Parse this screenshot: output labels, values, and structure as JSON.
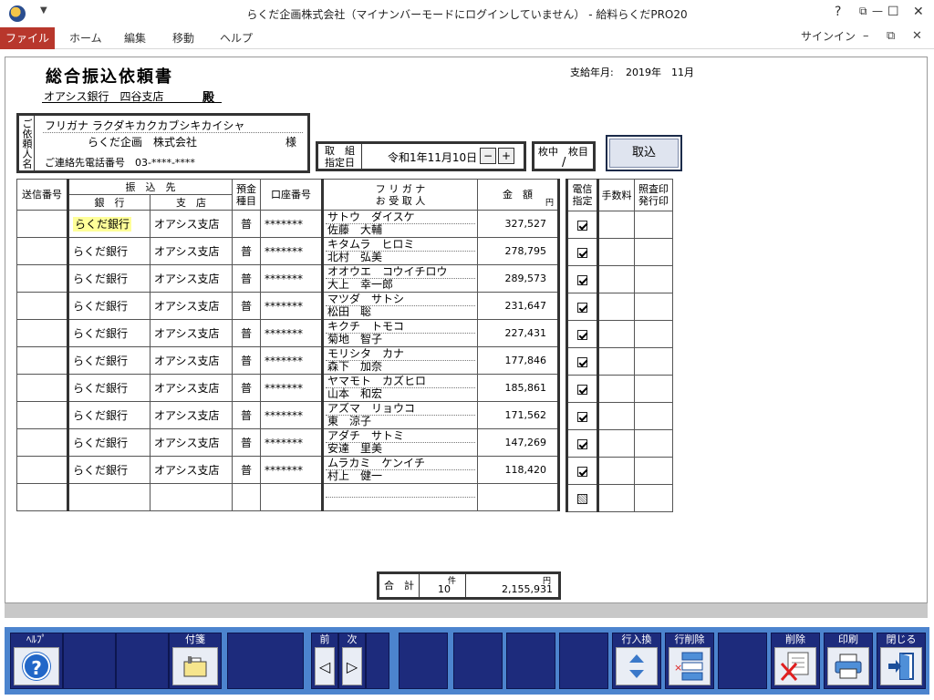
{
  "window": {
    "title": "らくだ企画株式会社（マイナンバーモードにログインしていません） - 給料らくだPRO20",
    "qat_glyph": "▼",
    "controls": {
      "help": "?",
      "restore": "⧉",
      "minimize": "—",
      "maximize": "☐",
      "close": "✕"
    }
  },
  "menu": {
    "file": "ファイル",
    "items": [
      "ホーム",
      "編集",
      "移動",
      "ヘルプ"
    ],
    "signin": "サインイン",
    "sub_minimize": "–",
    "sub_restore": "⧉",
    "sub_close": "✕"
  },
  "form": {
    "title": "総合振込依頼書",
    "bank": "オアシス銀行　四谷支店",
    "dono": "殿",
    "payday_label": "支給年月:",
    "payday_value": "2019年　11月",
    "client_label": "ご依頼人名",
    "client_kana": "フリガナ ラクダキカクカブシキカイシャ",
    "client_name": "らくだ企画　株式会社",
    "client_sama": "様",
    "client_tel": "ご連絡先電話番号　03-****-****",
    "date_label": "取　組\n指定日",
    "date_value": "令和1年11月10日",
    "date_minus": "−",
    "date_plus": "+",
    "sheet_label": "枚中　枚目",
    "sheet_slash": "/",
    "import_button": "取込"
  },
  "table": {
    "headers": {
      "send_no": "送信番号",
      "furikomi": "振　込　先",
      "bank": "銀　行",
      "branch": "支　店",
      "kind": "預金\n種目",
      "account": "口座番号",
      "recipient": "フ リ ガ ナ\nお 受 取 人",
      "amount": "金　額",
      "amount_unit": "円"
    },
    "rows": [
      {
        "bank": "らくだ銀行",
        "branch": "オアシス支店",
        "kind": "普",
        "account": "*******",
        "kana": "サトウ　ダイスケ",
        "name": "佐藤　大輔",
        "amount": "327,527"
      },
      {
        "bank": "らくだ銀行",
        "branch": "オアシス支店",
        "kind": "普",
        "account": "*******",
        "kana": "キタムラ　ヒロミ",
        "name": "北村　弘美",
        "amount": "278,795"
      },
      {
        "bank": "らくだ銀行",
        "branch": "オアシス支店",
        "kind": "普",
        "account": "*******",
        "kana": "オオウエ　コウイチロウ",
        "name": "大上　幸一郎",
        "amount": "289,573"
      },
      {
        "bank": "らくだ銀行",
        "branch": "オアシス支店",
        "kind": "普",
        "account": "*******",
        "kana": "マツダ　サトシ",
        "name": "松田　聡",
        "amount": "231,647"
      },
      {
        "bank": "らくだ銀行",
        "branch": "オアシス支店",
        "kind": "普",
        "account": "*******",
        "kana": "キクチ　トモコ",
        "name": "菊地　智子",
        "amount": "227,431"
      },
      {
        "bank": "らくだ銀行",
        "branch": "オアシス支店",
        "kind": "普",
        "account": "*******",
        "kana": "モリシタ　カナ",
        "name": "森下　加奈",
        "amount": "177,846"
      },
      {
        "bank": "らくだ銀行",
        "branch": "オアシス支店",
        "kind": "普",
        "account": "*******",
        "kana": "ヤマモト　カズヒロ",
        "name": "山本　和宏",
        "amount": "185,861"
      },
      {
        "bank": "らくだ銀行",
        "branch": "オアシス支店",
        "kind": "普",
        "account": "*******",
        "kana": "アズマ　リョウコ",
        "name": "東　涼子",
        "amount": "171,562"
      },
      {
        "bank": "らくだ銀行",
        "branch": "オアシス支店",
        "kind": "普",
        "account": "*******",
        "kana": "アダチ　サトミ",
        "name": "安達　里美",
        "amount": "147,269"
      },
      {
        "bank": "らくだ銀行",
        "branch": "オアシス支店",
        "kind": "普",
        "account": "*******",
        "kana": "ムラカミ　ケンイチ",
        "name": "村上　健一",
        "amount": "118,420"
      },
      {
        "bank": "",
        "branch": "",
        "kind": "",
        "account": "",
        "kana": "",
        "name": "",
        "amount": ""
      }
    ]
  },
  "side": {
    "headers": {
      "denshin": "電信\n指定",
      "fee": "手数料",
      "receipt": "照査印\n発行印"
    },
    "checks": [
      true,
      true,
      true,
      true,
      true,
      true,
      true,
      true,
      true,
      true,
      null
    ]
  },
  "total": {
    "label": "合　計",
    "count_unit": "件",
    "count": "10",
    "amount_unit": "円",
    "amount": "2,155,931"
  },
  "toolbar": {
    "help": "ﾍﾙﾌﾟ",
    "help_glyph": "?",
    "fusen": "付箋",
    "prev": "前",
    "next": "次",
    "prev_glyph": "◁",
    "next_glyph": "▷",
    "row_swap": "行入換",
    "row_delete": "行削除",
    "delete": "削除",
    "print": "印刷",
    "close": "閉じる"
  },
  "colors": {
    "accent_file_menu": "#b8372c",
    "toolbar_bg": "#4c84ce",
    "toolbar_button": "#1d2b7c",
    "highlight": "#ffff99"
  }
}
